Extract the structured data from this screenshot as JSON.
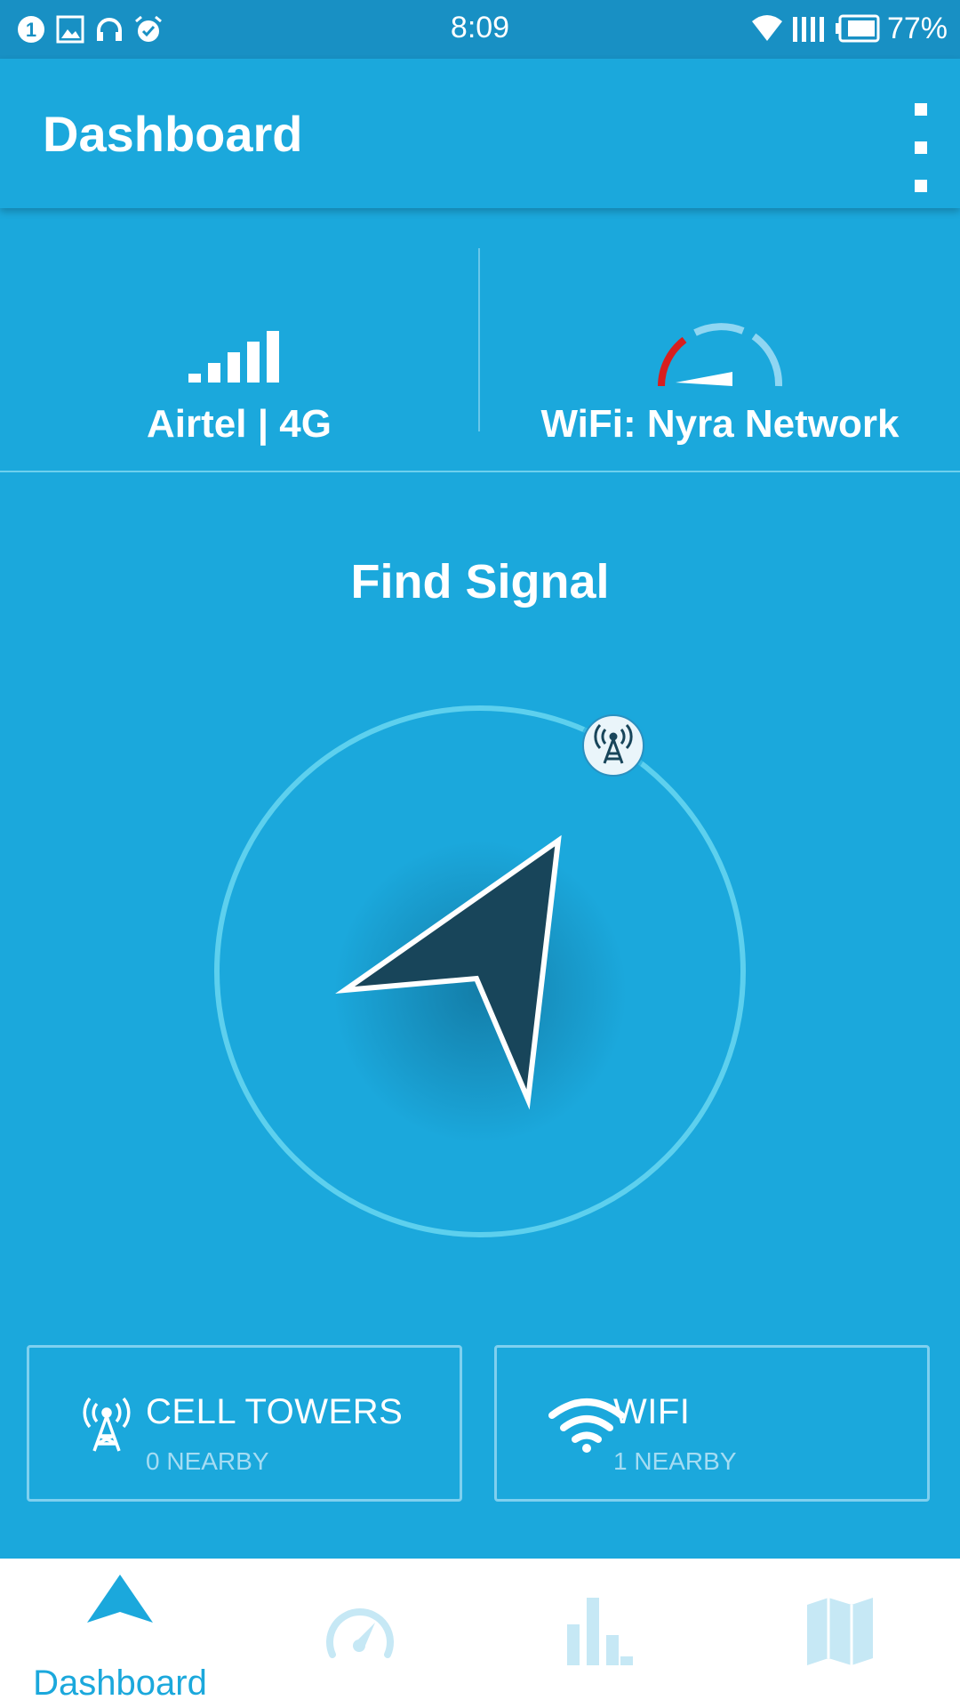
{
  "status_bar": {
    "time": "8:09",
    "battery_percent": "77%",
    "notification_badge": "1",
    "icons": [
      "notification-count-icon",
      "image-icon",
      "headphones-icon",
      "alarm-icon",
      "wifi-icon",
      "signal-icon",
      "battery-icon"
    ]
  },
  "app_bar": {
    "title": "Dashboard",
    "menu_icon": "overflow-menu-icon"
  },
  "network": {
    "cell": {
      "label": "Airtel | 4G",
      "icon": "signal-bars-icon"
    },
    "wifi": {
      "label": "WiFi: Nyra Network",
      "icon": "speed-gauge-icon"
    }
  },
  "find_signal": {
    "title": "Find Signal",
    "pointer_icon": "navigation-arrow-icon",
    "tower_marker_icon": "cell-tower-icon"
  },
  "tiles": [
    {
      "title": "CELL TOWERS",
      "subtitle": "0 NEARBY",
      "icon": "cell-tower-icon"
    },
    {
      "title": "WIFI",
      "subtitle": "1 NEARBY",
      "icon": "wifi-icon"
    }
  ],
  "bottom_nav": {
    "items": [
      {
        "label": "Dashboard",
        "icon": "dashboard-arrow-icon",
        "active": true
      },
      {
        "label": "",
        "icon": "speedometer-icon",
        "active": false
      },
      {
        "label": "",
        "icon": "bar-chart-icon",
        "active": false
      },
      {
        "label": "",
        "icon": "map-icon",
        "active": false
      }
    ]
  },
  "colors": {
    "primary": "#1ba8dc",
    "status_bar": "#1890c4",
    "ring": "#5dd0ee",
    "arrow": "#18455a",
    "inactive_nav": "#c6e8f5",
    "gauge_red": "#d81e1e"
  }
}
